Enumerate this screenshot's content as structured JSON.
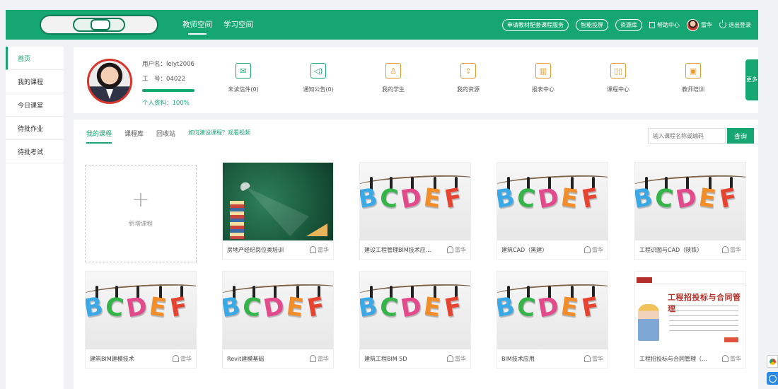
{
  "header": {
    "nav": [
      "教师空间",
      "学习空间"
    ],
    "pills": [
      "申请教材配套课程服务",
      "智能投屏",
      "资源库"
    ],
    "help": "帮助中心",
    "user": "雷华",
    "logout": "退出登录",
    "brand_color": "#16a672"
  },
  "sidebar": {
    "items": [
      {
        "label": "首页"
      },
      {
        "label": "我的课程"
      },
      {
        "label": "今日课堂"
      },
      {
        "label": "待批作业"
      },
      {
        "label": "待批考试"
      }
    ]
  },
  "profile": {
    "username": "用户名：leiyt2006",
    "employee_no": "工　号：04022",
    "completion": "个人资料：100%",
    "completion_value": 100,
    "more": "更多",
    "stats": [
      {
        "label": "未读信件(0)",
        "icon": "mail-icon"
      },
      {
        "label": "通知公告(0)",
        "icon": "speaker-icon"
      },
      {
        "label": "我的学生",
        "icon": "student-icon"
      },
      {
        "label": "我的资源",
        "icon": "resource-icon"
      },
      {
        "label": "报表中心",
        "icon": "report-icon"
      },
      {
        "label": "课程中心",
        "icon": "course-center-icon"
      },
      {
        "label": "教师培训",
        "icon": "training-icon"
      }
    ]
  },
  "courses": {
    "tabs": [
      "我的课程",
      "课程库",
      "回收站"
    ],
    "video_link": "如何建设课程？观看视频",
    "search_placeholder": "输入课程名称或编码",
    "search_button": "查询",
    "add_label": "新增课程",
    "items": [
      {
        "title": "房地产经纪岗位类培训",
        "author": "雷华"
      },
      {
        "title": "建设工程管理BIM技术应...",
        "author": "雷华"
      },
      {
        "title": "建筑CAD（黑建）",
        "author": "雷华"
      },
      {
        "title": "工程识图与CAD（陕铁）",
        "author": "雷华"
      },
      {
        "title": "建筑BIM建模技术",
        "author": "雷华"
      },
      {
        "title": "Revit建模基础",
        "author": "雷华"
      },
      {
        "title": "建筑工程BIM 5D",
        "author": "雷华"
      },
      {
        "title": "BIM技术应用",
        "author": "雷华"
      },
      {
        "title": "工程招投标与合同管理（...",
        "author": "雷华"
      }
    ],
    "letters": "BCDEF",
    "contract_title": "工程招投标与合同管理"
  }
}
